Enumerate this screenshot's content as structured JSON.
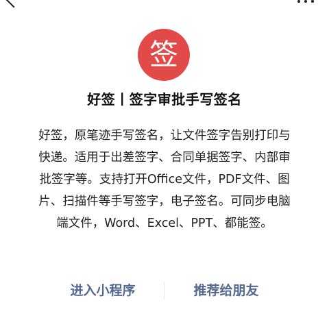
{
  "logo": {
    "glyph": "签",
    "color": "#e24a4a",
    "icon": "signature-logo-icon"
  },
  "title": "好签丨签字审批手写签名",
  "description": "好签，原笔迹手写签名，让文件签字告别打印与快递。适用于出差签字、合同单据签字、内部审批签字等。支持打开Office文件，PDF文件、图片、扫描件等手写签字，电子签名。可同步电脑端文件，Word、Excel、PPT、都能签。",
  "actions": {
    "enter_label": "进入小程序",
    "share_label": "推荐给朋友",
    "color": "#55688f"
  },
  "icons": {
    "back": "back-arrow-icon",
    "more": "more-dots-icon"
  }
}
